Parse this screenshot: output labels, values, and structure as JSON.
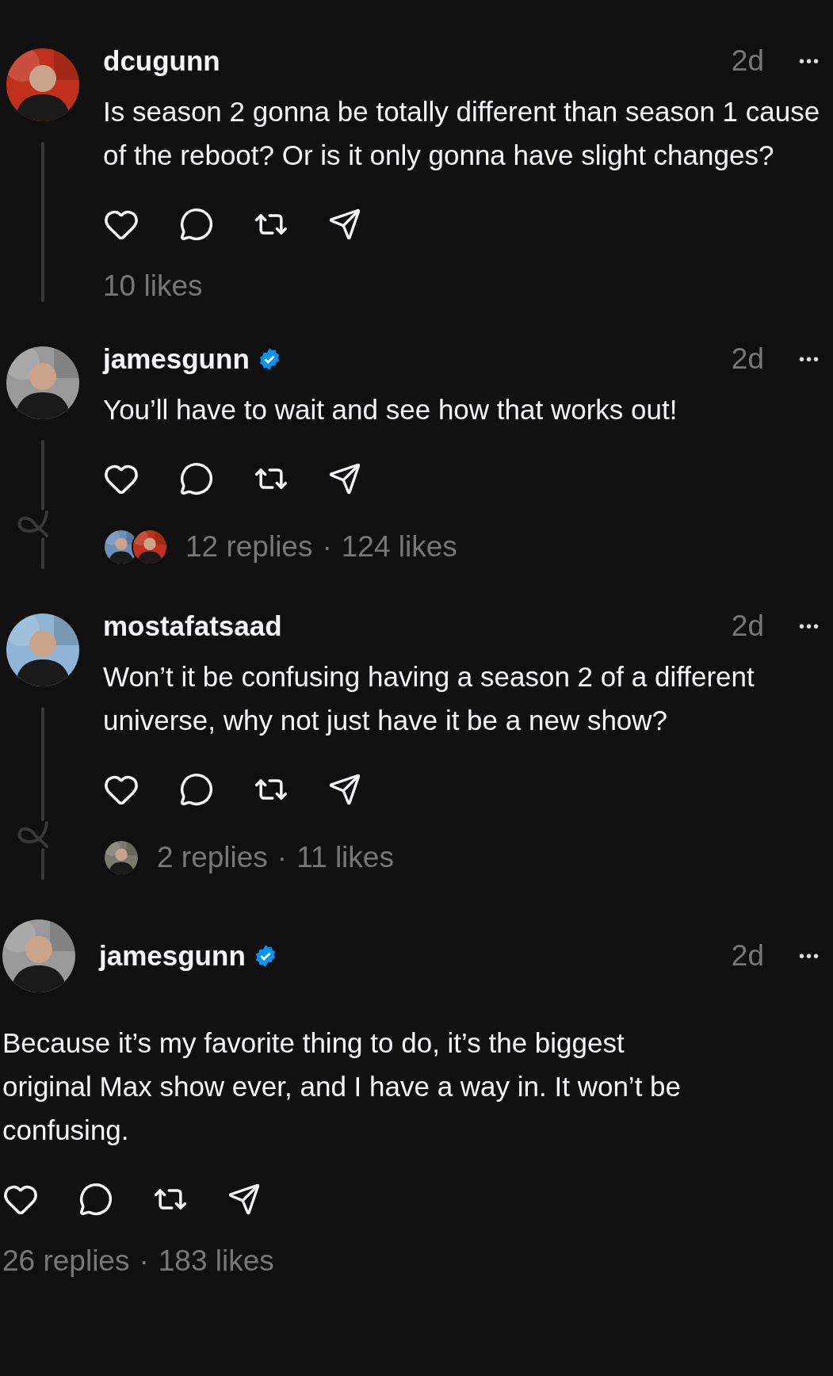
{
  "posts": [
    {
      "kind": "reply",
      "username": "dcugunn",
      "verified": false,
      "time": "2d",
      "menu": "•••",
      "text": "Is season 2 gonna be totally different than season 1 cause of the reboot? Or is it only gonna have slight changes?",
      "avatar": {
        "kind": "picture",
        "color": "#c0301c"
      },
      "thread_line": true,
      "stats": [
        "10 likes"
      ]
    },
    {
      "kind": "reply",
      "username": "jamesgunn",
      "verified": true,
      "time": "2d",
      "menu": "•••",
      "text": "You’ll have to wait and see how that works out!",
      "avatar": {
        "kind": "picture",
        "color": "#9a9a9a"
      },
      "thread_line": true,
      "reply_avatars": [
        {
          "kind": "picture",
          "color": "#6a8fb8"
        },
        {
          "kind": "picture",
          "color": "#c0301c"
        }
      ],
      "separator": "·",
      "stats": [
        "12 replies",
        "124 likes"
      ]
    },
    {
      "kind": "reply",
      "username": "mostafatsaad",
      "verified": false,
      "time": "2d",
      "menu": "•••",
      "text": "Won’t it be confusing having a season 2 of a different universe, why not just have it be a new show?",
      "avatar": {
        "kind": "picture",
        "color": "#8fb4d6"
      },
      "thread_line": true,
      "reply_avatars": [
        {
          "kind": "picture",
          "color": "#7a7a70"
        }
      ],
      "separator": "·",
      "stats": [
        "2 replies",
        "11 likes"
      ]
    },
    {
      "kind": "focus",
      "username": "jamesgunn",
      "verified": true,
      "time": "2d",
      "menu": "•••",
      "text": "Because it’s my favorite thing to do, it’s the biggest original Max show ever, and I have a way in. It won’t be confusing.",
      "avatar": {
        "kind": "picture",
        "color": "#9a9a9a"
      },
      "thread_line": false,
      "separator": "·",
      "stats": [
        "26 replies",
        "183 likes"
      ]
    }
  ]
}
